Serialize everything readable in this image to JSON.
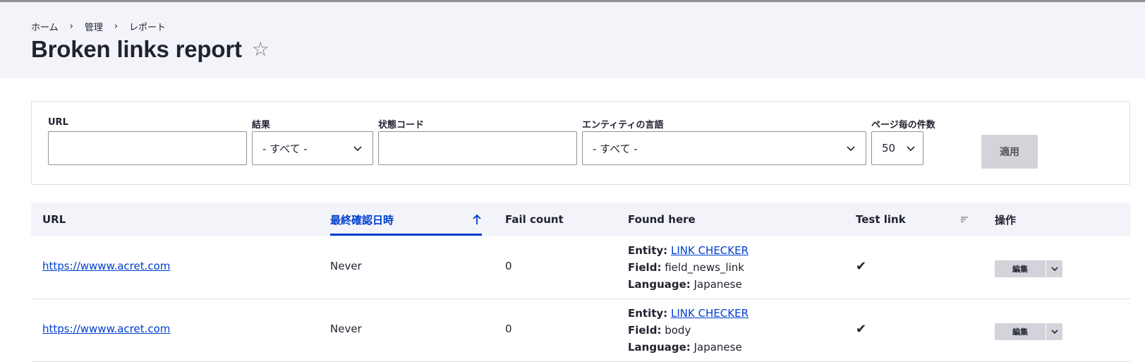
{
  "breadcrumb": [
    "ホーム",
    "管理",
    "レポート"
  ],
  "page_title": "Broken links report",
  "filters": {
    "url_label": "URL",
    "url_value": "",
    "result_label": "結果",
    "result_value": "- すべて -",
    "status_label": "状態コード",
    "status_value": "",
    "language_label": "エンティティの言語",
    "language_value": "- すべて -",
    "per_page_label": "ページ毎の件数",
    "per_page_value": "50",
    "apply_label": "適用"
  },
  "table": {
    "headers": {
      "url": "URL",
      "last_checked": "最終確認日時",
      "fail_count": "Fail count",
      "found_here": "Found here",
      "test_link": "Test link",
      "operations": "操作"
    },
    "rows": [
      {
        "url": "https://wwww.acret.com",
        "last_checked": "Never",
        "fail_count": "0",
        "entity_label": "Entity:",
        "entity": "LINK CHECKER",
        "field_label": "Field:",
        "field": "field_news_link",
        "language_label": "Language:",
        "language": "Japanese",
        "test_link": "✔",
        "op_label": "編集"
      },
      {
        "url": "https://wwww.acret.com",
        "last_checked": "Never",
        "fail_count": "0",
        "entity_label": "Entity:",
        "entity": "LINK CHECKER",
        "field_label": "Field:",
        "field": "body",
        "language_label": "Language:",
        "language": "Japanese",
        "test_link": "✔",
        "op_label": "編集"
      }
    ]
  }
}
